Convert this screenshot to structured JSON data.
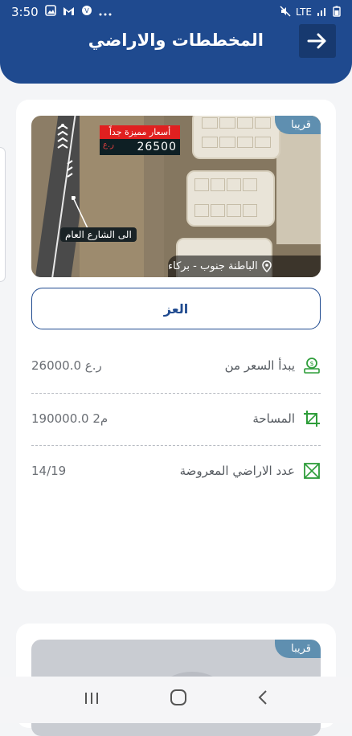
{
  "status_bar": {
    "time": "3:50",
    "left_icons": [
      "gallery-icon",
      "mail-icon",
      "vpn-icon",
      "more-icon"
    ],
    "network": "LTE",
    "right_icons": [
      "mute-icon",
      "signal-icon",
      "battery-icon"
    ]
  },
  "header": {
    "title": "المخططات والاراضي",
    "back_icon": "arrow-right-icon"
  },
  "listing": {
    "badge": "قريبا",
    "map": {
      "promo_text": "أسعار مميزة جداً",
      "promo_price": "26500",
      "promo_currency": "ر.ع",
      "road_label": "الى الشارع العام",
      "location": "الباطنة جنوب - بركاء"
    },
    "name": "العز",
    "details": [
      {
        "icon": "money-icon",
        "label": "يبدأ السعر من",
        "value": "26000.0 ر.ع"
      },
      {
        "icon": "area-icon",
        "label": "المساحة",
        "value": "190000.0 م2"
      },
      {
        "icon": "plots-icon",
        "label": "عدد الاراضي المعروضة",
        "value": "14/19"
      }
    ]
  },
  "listing2": {
    "badge": "قريبا"
  },
  "colors": {
    "primary": "#1f4a8f",
    "badge": "#5f8fb0",
    "icon_green": "#2e9d3a",
    "promo_red": "#e02020"
  }
}
